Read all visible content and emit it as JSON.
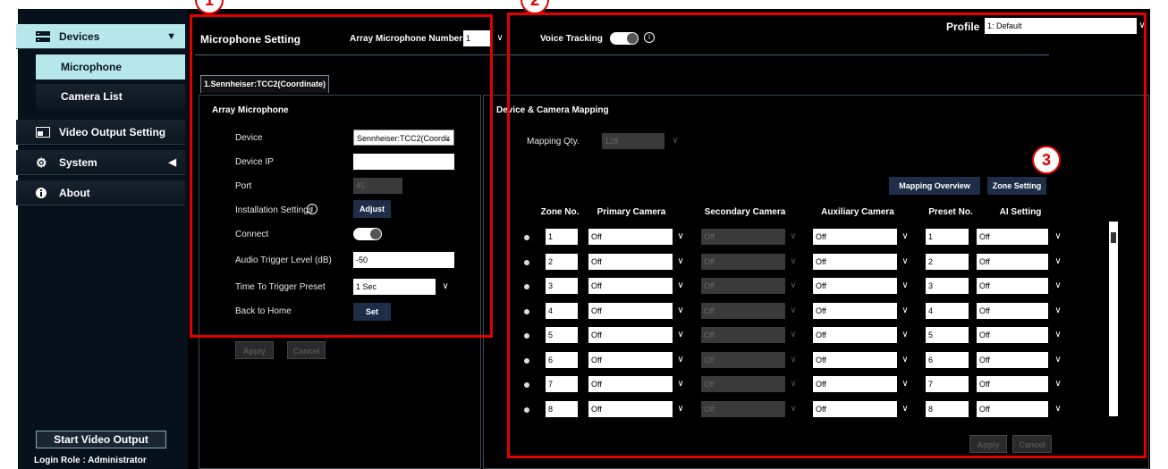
{
  "sidebar": {
    "devices": "Devices",
    "microphone": "Microphone",
    "camera_list": "Camera List",
    "video_output": "Video Output Setting",
    "system": "System",
    "about": "About",
    "start_video_output": "Start Video Output",
    "login_role": "Login Role :  Administrator"
  },
  "header": {
    "title": "Microphone Setting",
    "array_mic_numbers_label": "Array Microphone Numbers",
    "array_mic_numbers_value": "1",
    "voice_tracking_label": "Voice Tracking",
    "profile_label": "Profile",
    "profile_value": "1: Default"
  },
  "mic_tab": "1.Sennheiser:TCC2(Coordinate)",
  "array_mic": {
    "section_title": "Array Microphone",
    "device_label": "Device",
    "device_value": "Sennheiser:TCC2(Coordir",
    "device_ip_label": "Device IP",
    "device_ip_value": "",
    "port_label": "Port",
    "port_value": "45",
    "installation_label": "Installation Settings",
    "adjust_btn": "Adjust",
    "connect_label": "Connect",
    "audio_trigger_label": "Audio Trigger Level (dB)",
    "audio_trigger_value": "-50",
    "time_trigger_label": "Time To Trigger Preset",
    "time_trigger_value": "1 Sec",
    "back_home_label": "Back to Home",
    "set_btn": "Set",
    "apply_btn": "Apply",
    "cancel_btn": "Cancel"
  },
  "mapping": {
    "section_title": "Device & Camera Mapping",
    "qty_label": "Mapping Qty.",
    "qty_value": "128",
    "overview_btn": "Mapping Overview",
    "zone_setting_btn": "Zone Setting",
    "columns": [
      "Zone No.",
      "Primary Camera",
      "Secondary Camera",
      "Auxiliary Camera",
      "Preset No.",
      "AI Setting"
    ],
    "rows": [
      {
        "zone": "1",
        "primary": "Off",
        "secondary": "Off",
        "aux": "Off",
        "preset": "1",
        "ai": "Off"
      },
      {
        "zone": "2",
        "primary": "Off",
        "secondary": "Off",
        "aux": "Off",
        "preset": "2",
        "ai": "Off"
      },
      {
        "zone": "3",
        "primary": "Off",
        "secondary": "Off",
        "aux": "Off",
        "preset": "3",
        "ai": "Off"
      },
      {
        "zone": "4",
        "primary": "Off",
        "secondary": "Off",
        "aux": "Off",
        "preset": "4",
        "ai": "Off"
      },
      {
        "zone": "5",
        "primary": "Off",
        "secondary": "Off",
        "aux": "Off",
        "preset": "5",
        "ai": "Off"
      },
      {
        "zone": "6",
        "primary": "Off",
        "secondary": "Off",
        "aux": "Off",
        "preset": "6",
        "ai": "Off"
      },
      {
        "zone": "7",
        "primary": "Off",
        "secondary": "Off",
        "aux": "Off",
        "preset": "7",
        "ai": "Off"
      },
      {
        "zone": "8",
        "primary": "Off",
        "secondary": "Off",
        "aux": "Off",
        "preset": "8",
        "ai": "Off"
      }
    ],
    "apply_btn": "Apply",
    "cancel_btn": "Cancel"
  },
  "callouts": {
    "one": "1",
    "two": "2",
    "three": "3"
  },
  "colors": {
    "annotation_red": "#e30000",
    "nav_active": "#b5e7ec",
    "button_navy": "#1e2e48"
  }
}
